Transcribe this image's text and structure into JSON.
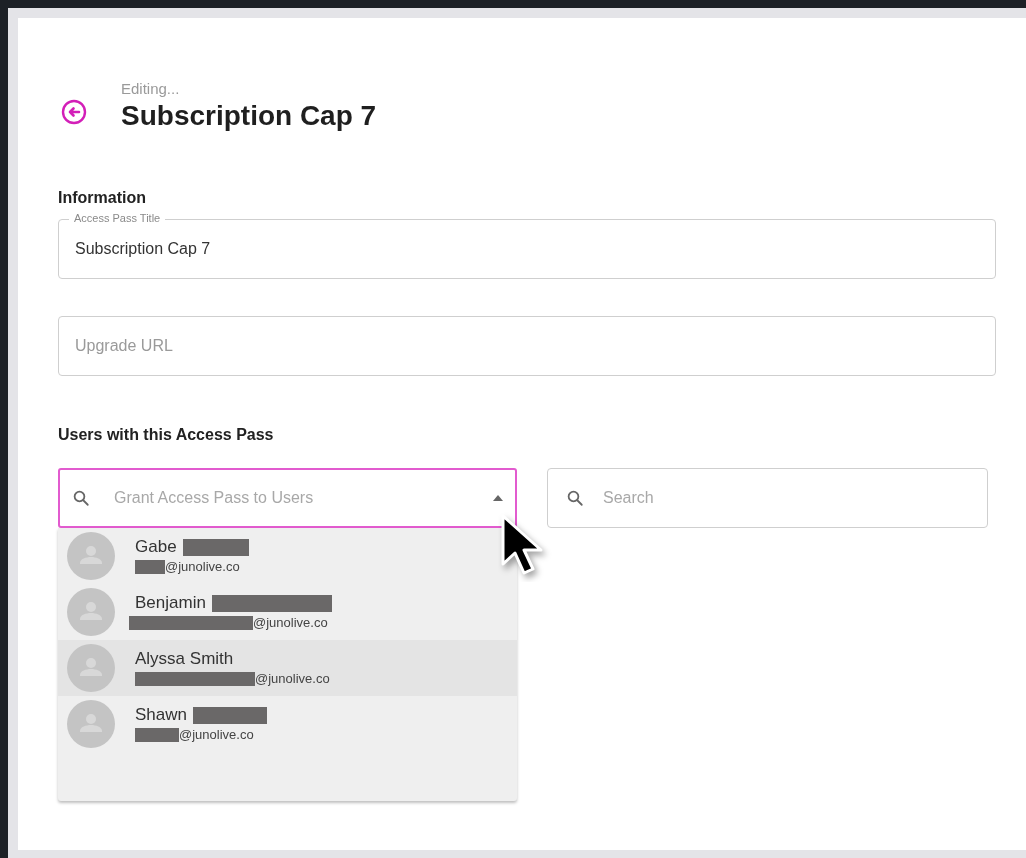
{
  "header": {
    "subtitle": "Editing...",
    "title": "Subscription Cap 7"
  },
  "information": {
    "heading": "Information",
    "fields": [
      {
        "label": "Access Pass Title",
        "value": "Subscription Cap 7"
      },
      {
        "placeholder": "Upgrade URL"
      }
    ]
  },
  "users": {
    "heading": "Users with this Access Pass",
    "grant_field": {
      "placeholder": "Grant Access Pass to Users",
      "expanded": true
    },
    "search_field": {
      "placeholder": "Search"
    },
    "options": [
      {
        "name": "Gabe",
        "email": "@junolive.co",
        "selected": false
      },
      {
        "name": "Benjamin",
        "email": "@junolive.co",
        "selected": false
      },
      {
        "name": "Alyssa Smith",
        "email": "@junolive.co",
        "selected": true
      },
      {
        "name": "Shawn",
        "email": "@junolive.co",
        "selected": false
      }
    ]
  }
}
